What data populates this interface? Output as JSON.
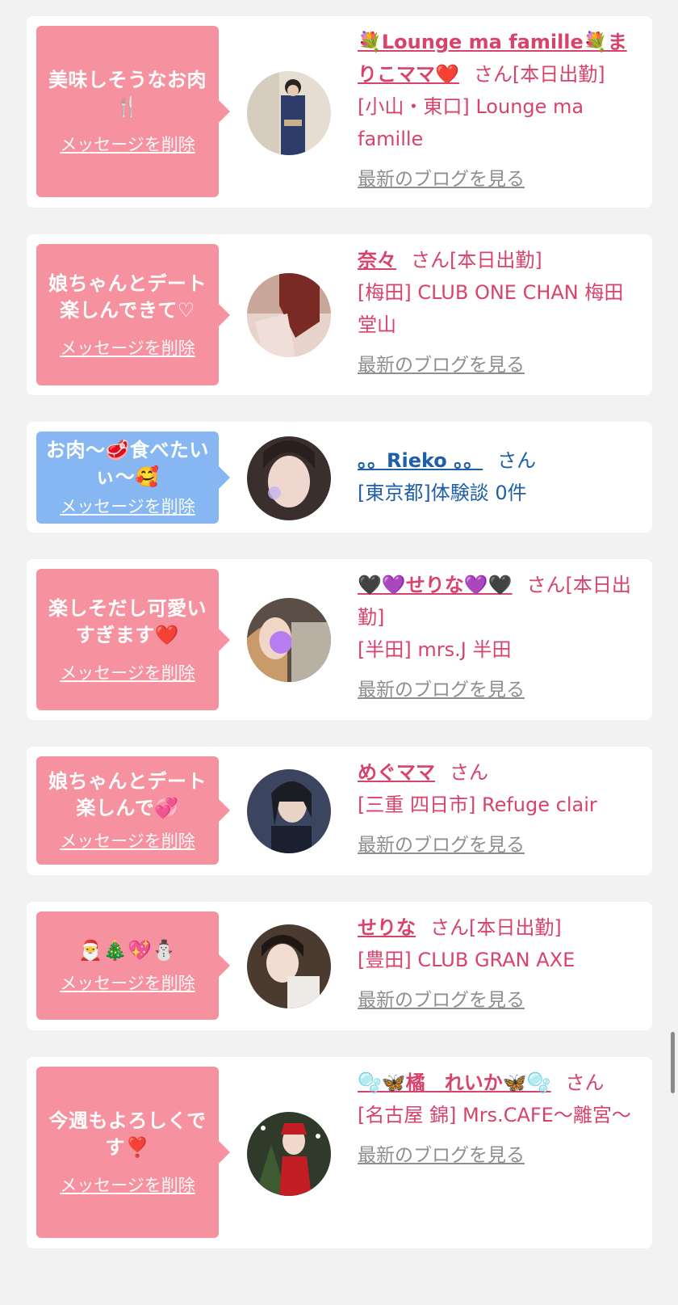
{
  "delete_label": "メッセージを削除",
  "san_label": "さん",
  "blog_label": "最新のブログを見る",
  "items": [
    {
      "message": "美味しそうなお肉🍴",
      "name": "💐Lounge ma famille💐まりこママ❤️",
      "status": "[本日出勤]",
      "shop": "[小山・東口] Lounge ma famille",
      "has_blog": true,
      "theme": "pink"
    },
    {
      "message": "娘ちゃんとデート楽しんできて♡",
      "name": "奈々",
      "status": "[本日出勤]",
      "shop": "[梅田] CLUB ONE CHAN 梅田堂山",
      "has_blog": true,
      "theme": "pink"
    },
    {
      "message": "お肉〜🥩食べたいぃ〜🥰",
      "name": "。。Rieko 。。",
      "status": "",
      "shop": "[東京都]体験談 0件",
      "has_blog": false,
      "theme": "blue"
    },
    {
      "message": "楽しそだし可愛いすぎます❤️",
      "name": "🖤💜せりな💜🖤",
      "status": "[本日出勤]",
      "shop": "[半田] mrs.J 半田",
      "has_blog": true,
      "theme": "pink"
    },
    {
      "message": "娘ちゃんとデート楽しんで💞",
      "name": "めぐママ",
      "status": "",
      "shop": "[三重 四日市] Refuge clair",
      "has_blog": true,
      "theme": "pink"
    },
    {
      "message": "🎅🎄💖⛄",
      "name": "せりな",
      "status": "[本日出勤]",
      "shop": "[豊田] CLUB GRAN AXE",
      "has_blog": true,
      "theme": "pink"
    },
    {
      "message": "今週もよろしくです❣️",
      "name": "🫧🦋橘　れいか🦋🫧",
      "status": "",
      "shop": "[名古屋 錦] Mrs.CAFE〜離宮〜",
      "has_blog": true,
      "theme": "pink"
    }
  ]
}
